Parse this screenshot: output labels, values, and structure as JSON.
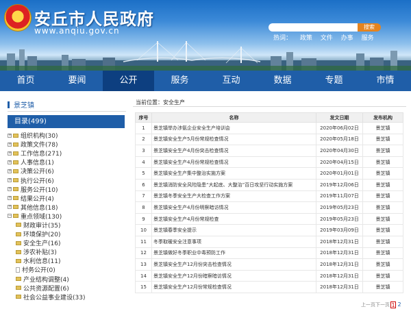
{
  "header": {
    "title": "安丘市人民政府",
    "url": "www.anqiu.gov.cn",
    "search_button": "搜索",
    "hot_label": "热词：",
    "hot_words": [
      "政策",
      "文件",
      "办事",
      "服务"
    ]
  },
  "nav": [
    "首页",
    "要闻",
    "公开",
    "服务",
    "互动",
    "数据",
    "专题",
    "市情"
  ],
  "nav_active": 2,
  "sidebar": {
    "section": "景芝镇",
    "directory": "目录(499)",
    "items": [
      {
        "label": "组织机构(30)",
        "kind": "folder"
      },
      {
        "label": "政策文件(78)",
        "kind": "folder"
      },
      {
        "label": "工作信息(271)",
        "kind": "folder"
      },
      {
        "label": "人事信息(1)",
        "kind": "folder"
      },
      {
        "label": "决策公开(6)",
        "kind": "folder"
      },
      {
        "label": "执行公开(6)",
        "kind": "folder"
      },
      {
        "label": "服务公开(10)",
        "kind": "folder"
      },
      {
        "label": "结果公开(4)",
        "kind": "folder"
      },
      {
        "label": "其他信息(18)",
        "kind": "folder"
      },
      {
        "label": "重点领域(130)",
        "kind": "folder-open"
      },
      {
        "label": "财政审计(35)",
        "kind": "child-folder"
      },
      {
        "label": "环境保护(20)",
        "kind": "child-folder"
      },
      {
        "label": "安全生产(16)",
        "kind": "child-folder"
      },
      {
        "label": "涉农补贴(3)",
        "kind": "child-folder"
      },
      {
        "label": "水利信息(11)",
        "kind": "child-folder"
      },
      {
        "label": "村务公开(0)",
        "kind": "child-doc"
      },
      {
        "label": "产业结构调整(4)",
        "kind": "child-folder"
      },
      {
        "label": "公共资源配置(6)",
        "kind": "child-folder"
      },
      {
        "label": "社会公益事业建设(33)",
        "kind": "child-folder"
      }
    ]
  },
  "breadcrumb": "当前位置：安全生产",
  "table": {
    "headers": [
      "序号",
      "名称",
      "发文日期",
      "发布机构"
    ],
    "rows": [
      [
        "1",
        "景芝镇举办涉氨企业安全生产培训会",
        "2020年06月02日",
        "景芝镇"
      ],
      [
        "2",
        "景芝镇安全生产5月份常规检查情况",
        "2020年05月18日",
        "景芝镇"
      ],
      [
        "3",
        "景芝镇安全生产4月份突击检查情况",
        "2020年04月30日",
        "景芝镇"
      ],
      [
        "4",
        "景芝镇安全生产4月份常规检查情况",
        "2020年04月15日",
        "景芝镇"
      ],
      [
        "5",
        "景芝镇安全生产集中整治实施方案",
        "2020年01月01日",
        "景芝镇"
      ],
      [
        "6",
        "景芝镇消防安全风险隐患“大起底、大整治”百日攻坚行动实施方案",
        "2019年12月06日",
        "景芝镇"
      ],
      [
        "7",
        "景芝镇冬季安全生产大检查工作方案",
        "2019年11月07日",
        "景芝镇"
      ],
      [
        "8",
        "景芝镇安全生产4月份明察暗访情况",
        "2019年05月23日",
        "景芝镇"
      ],
      [
        "9",
        "景芝镇安全生产4月份常规检查",
        "2019年05月23日",
        "景芝镇"
      ],
      [
        "10",
        "景芝镇春季安全提示",
        "2019年03月09日",
        "景芝镇"
      ],
      [
        "11",
        "冬季取暖安全注意事项",
        "2018年12月31日",
        "景芝镇"
      ],
      [
        "12",
        "景芝镇做好冬季职业中毒预防工作",
        "2018年12月31日",
        "景芝镇"
      ],
      [
        "13",
        "景芝镇安全生产12月份突击检查情况",
        "2018年12月31日",
        "景芝镇"
      ],
      [
        "14",
        "景芝镇安全生产12月份暗察暗访情况",
        "2018年12月31日",
        "景芝镇"
      ],
      [
        "15",
        "景芝镇安全生产12月份常规检查情况",
        "2018年12月31日",
        "景芝镇"
      ]
    ]
  },
  "pager": {
    "prev": "上一页",
    "next": "下一页",
    "pages": [
      "1",
      "2"
    ],
    "current": "1"
  }
}
